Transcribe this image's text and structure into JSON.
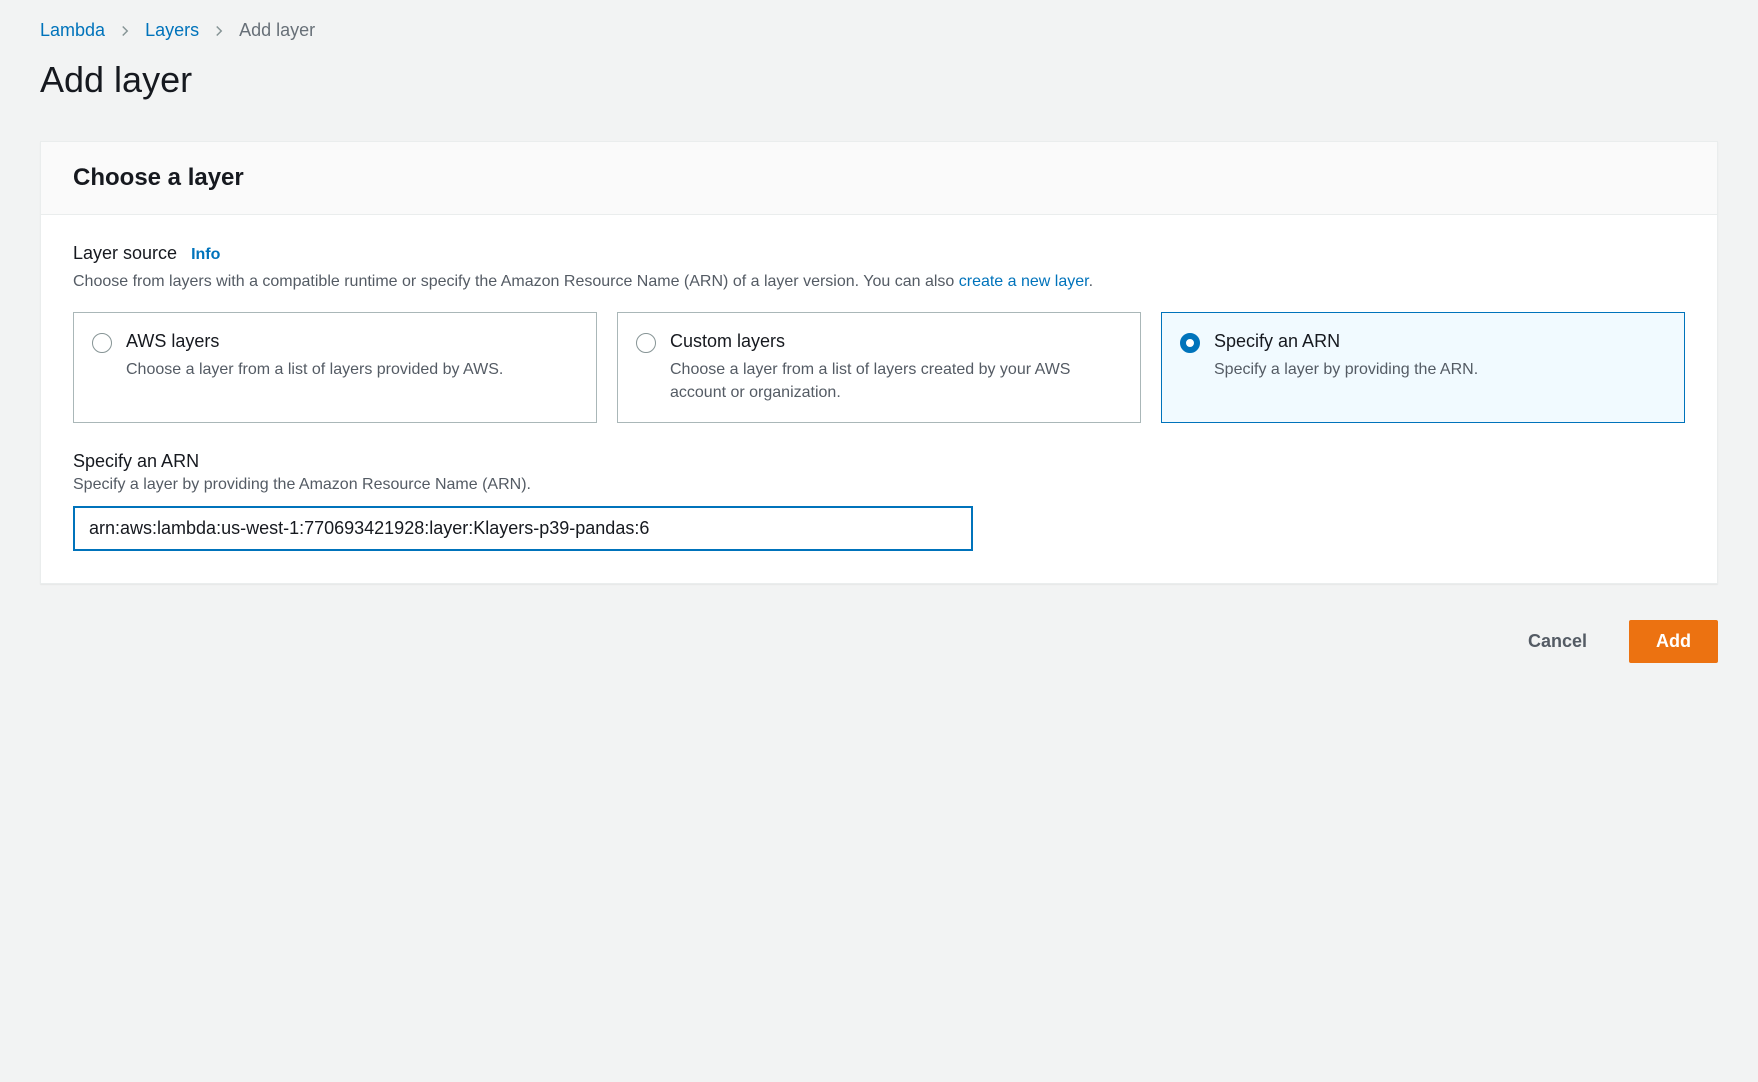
{
  "breadcrumb": {
    "items": [
      {
        "label": "Lambda",
        "link": true
      },
      {
        "label": "Layers",
        "link": true
      },
      {
        "label": "Add layer",
        "link": false
      }
    ]
  },
  "page_title": "Add layer",
  "panel": {
    "header": "Choose a layer",
    "layer_source": {
      "label": "Layer source",
      "info_label": "Info",
      "description_prefix": "Choose from layers with a compatible runtime or specify the Amazon Resource Name (ARN) of a layer version. You can also ",
      "description_link": "create a new layer",
      "description_suffix": "."
    },
    "options": [
      {
        "title": "AWS layers",
        "desc": "Choose a layer from a list of layers provided by AWS.",
        "selected": false
      },
      {
        "title": "Custom layers",
        "desc": "Choose a layer from a list of layers created by your AWS account or organization.",
        "selected": false
      },
      {
        "title": "Specify an ARN",
        "desc": "Specify a layer by providing the ARN.",
        "selected": true
      }
    ],
    "arn_field": {
      "label": "Specify an ARN",
      "desc": "Specify a layer by providing the Amazon Resource Name (ARN).",
      "value": "arn:aws:lambda:us-west-1:770693421928:layer:Klayers-p39-pandas:6"
    }
  },
  "footer": {
    "cancel": "Cancel",
    "add": "Add"
  }
}
